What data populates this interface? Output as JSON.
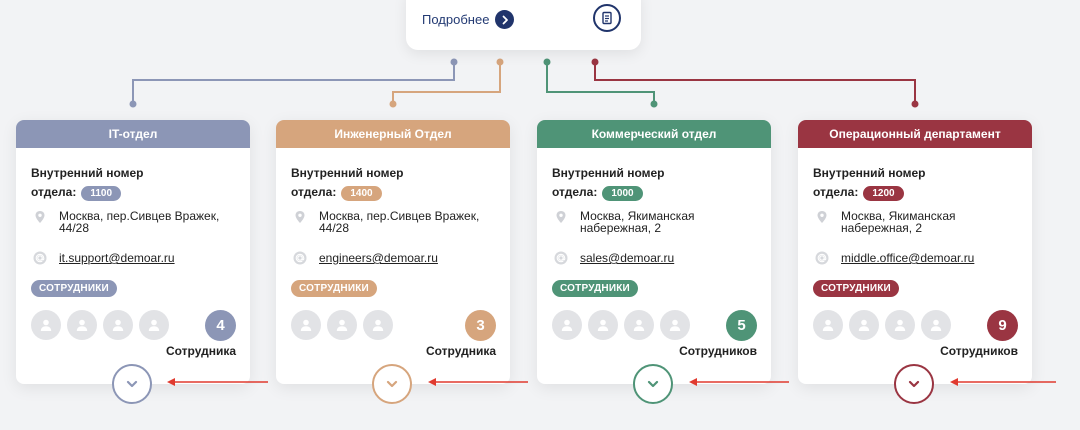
{
  "header": {
    "more_label": "Подробнее",
    "more_icon": "chevron-right-icon",
    "doc_icon": "document-icon"
  },
  "departments": [
    {
      "title": "IT-отдел",
      "color": "#8c96b6",
      "inner_label_1": "Внутренний номер",
      "inner_label_2": "отдела:",
      "number": "1100",
      "address": "Москва, пер.Сивцев Вражек, 44/28",
      "email": "it.support@demoar.ru",
      "staff_label": "СОТРУДНИКИ",
      "count": "4",
      "count_label": "Сотрудника"
    },
    {
      "title": "Инженерный Отдел",
      "color": "#d6a57d",
      "inner_label_1": "Внутренний номер",
      "inner_label_2": "отдела:",
      "number": "1400",
      "address": "Москва, пер.Сивцев Вражек, 44/28",
      "email": "engineers@demoar.ru",
      "staff_label": "СОТРУДНИКИ",
      "count": "3",
      "count_label": "Сотрудника"
    },
    {
      "title": "Коммерческий отдел",
      "color": "#4f9477",
      "inner_label_1": "Внутренний номер",
      "inner_label_2": "отдела:",
      "number": "1000",
      "address": "Москва, Якиманская набережная, 2",
      "email": "sales@demoar.ru",
      "staff_label": "СОТРУДНИКИ",
      "count": "5",
      "count_label": "Сотрудников"
    },
    {
      "title": "Операционный департамент",
      "color": "#9a3542",
      "inner_label_1": "Внутренний номер",
      "inner_label_2": "отдела:",
      "number": "1200",
      "address": "Москва, Якиманская набережная, 2",
      "email": "middle.office@demoar.ru",
      "staff_label": "СОТРУДНИКИ",
      "count": "9",
      "count_label": "Сотрудников"
    }
  ],
  "icons": {
    "location": "location-pin-icon",
    "email": "at-sign-icon",
    "avatar": "user-avatar-icon",
    "expand": "chevron-down-icon",
    "pointer": "red-arrow-left-icon"
  },
  "arrow_color": "#e03a2f"
}
